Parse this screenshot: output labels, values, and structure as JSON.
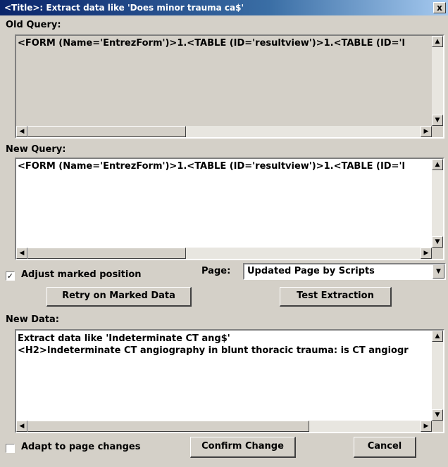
{
  "window": {
    "title": "<Title>: Extract data like 'Does minor trauma ca$'",
    "close_label": "x"
  },
  "old_query": {
    "label": "Old Query:",
    "value": "<FORM (Name='EntrezForm')>1.<TABLE (ID='resultview')>1.<TABLE (ID='l"
  },
  "new_query": {
    "label": "New Query:",
    "value": "<FORM (Name='EntrezForm')>1.<TABLE (ID='resultview')>1.<TABLE (ID='l"
  },
  "adjust": {
    "label": "Adjust marked position",
    "checked_mark": "✓"
  },
  "page": {
    "label": "Page:",
    "selected": "Updated Page by Scripts"
  },
  "buttons": {
    "retry": "Retry on Marked Data",
    "test": "Test Extraction",
    "confirm": "Confirm Change",
    "cancel": "Cancel"
  },
  "new_data": {
    "label": "New Data:",
    "line1": "Extract data like 'Indeterminate CT ang$'",
    "line2": "<H2>Indeterminate CT angiography in blunt thoracic trauma: is CT angiogr"
  },
  "adapt": {
    "label": "Adapt to page changes"
  },
  "icons": {
    "scroll_up": "▲",
    "scroll_down": "▼",
    "scroll_left": "◀",
    "scroll_right": "▶",
    "dropdown": "▼"
  }
}
